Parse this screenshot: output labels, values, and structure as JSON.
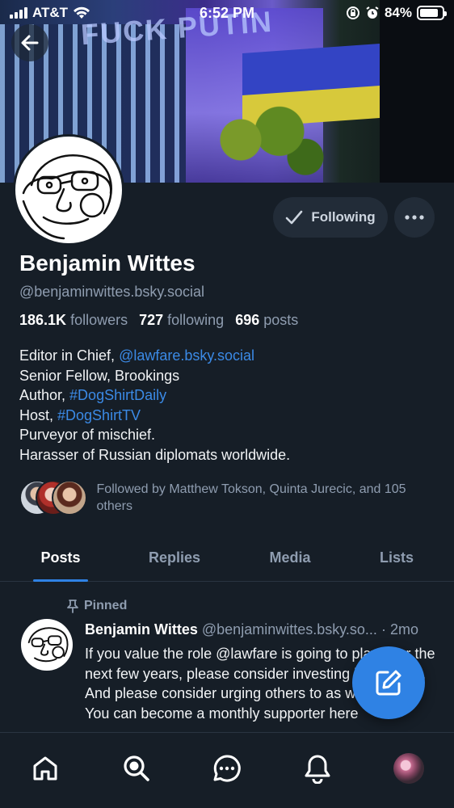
{
  "status_bar": {
    "carrier": "AT&T",
    "time": "6:52 PM",
    "battery": "84%",
    "battery_level": 0.84
  },
  "banner": {
    "overlay_text": "FUCK PUTIN"
  },
  "profile": {
    "name": "Benjamin Wittes",
    "handle": "@benjaminwittes.bsky.social",
    "following_button": "Following",
    "stats": {
      "followers_count": "186.1K",
      "followers_label": "followers",
      "following_count": "727",
      "following_label": "following",
      "posts_count": "696",
      "posts_label": "posts"
    },
    "bio": {
      "line1_prefix": "Editor in Chief, ",
      "line1_link": "@lawfare.bsky.social",
      "line2": "Senior Fellow, Brookings",
      "line3_prefix": "Author, ",
      "line3_link": "#DogShirtDaily",
      "line4_prefix": "Host, ",
      "line4_link": "#DogShirtTV",
      "line5": "Purveyor of mischief.",
      "line6": "Harasser of Russian diplomats worldwide."
    },
    "followed_by": "Followed by Matthew Tokson, Quinta Jurecic, and 105 others"
  },
  "tabs": [
    {
      "label": "Posts",
      "active": true
    },
    {
      "label": "Replies",
      "active": false
    },
    {
      "label": "Media",
      "active": false
    },
    {
      "label": "Lists",
      "active": false
    }
  ],
  "post": {
    "pinned_label": "Pinned",
    "author": "Benjamin Wittes",
    "handle": "@benjaminwittes.bsky.so...",
    "separator": "·",
    "time": "2mo",
    "text": "If you value the role @lawfare is going to play over the next few years, please consider investing in that role. And please consider urging others to as well.\nYou can become a monthly supporter here"
  },
  "colors": {
    "background": "#161e27",
    "accent": "#2f82e4",
    "link": "#3b8ae6",
    "muted_text": "#8f9db0",
    "button_bg": "#222c38"
  },
  "icons": {
    "back": "arrow-left-icon",
    "following_check": "checkmark-icon",
    "more": "ellipsis-icon",
    "pin": "pin-icon",
    "compose": "compose-icon",
    "nav": [
      "home-icon",
      "search-icon",
      "chat-icon",
      "bell-icon",
      "profile-avatar"
    ]
  }
}
